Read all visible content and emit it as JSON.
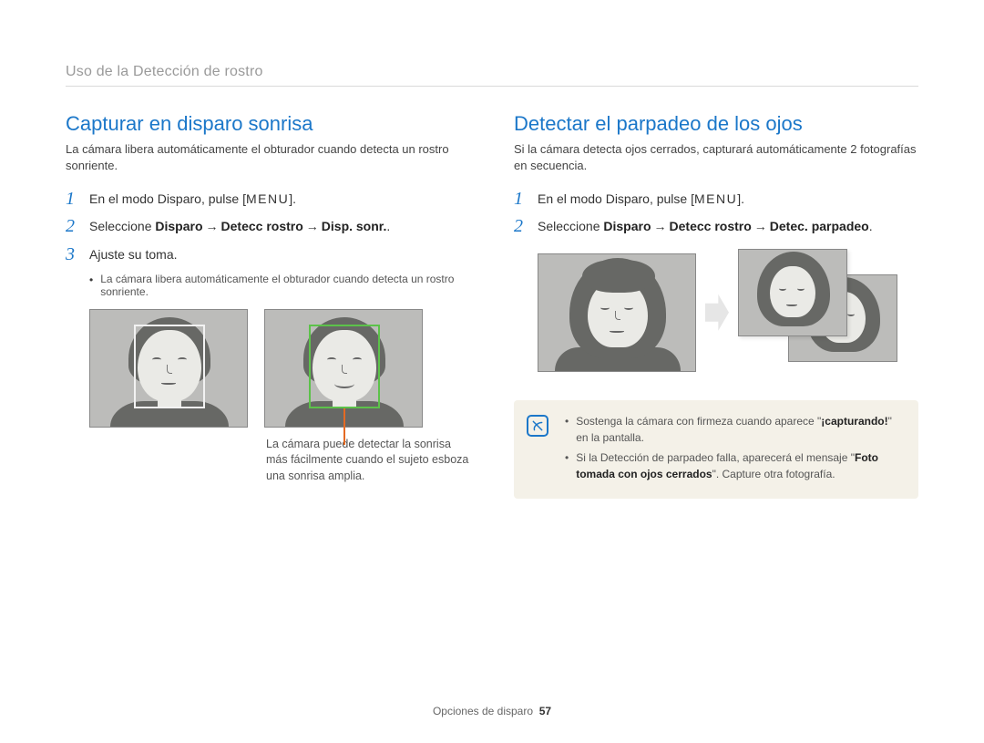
{
  "breadcrumb": "Uso de la Detección de rostro",
  "left": {
    "heading": "Capturar en disparo sonrisa",
    "intro": "La cámara libera automáticamente el obturador cuando detecta un rostro sonriente.",
    "step1_pre": "En el modo Disparo, pulse [",
    "step1_menu": "MENU",
    "step1_post": "].",
    "step2_pre": "Seleccione ",
    "step2_b1": "Disparo",
    "step2_arrow": "→",
    "step2_b2": "Detecc rostro",
    "step2_b3": "Disp. sonr.",
    "step2_post": ".",
    "step3": "Ajuste su toma.",
    "step3_bullet": "La cámara libera automáticamente el obturador cuando detecta un rostro sonriente.",
    "caption": "La cámara puede detectar la sonrisa más fácilmente cuando el sujeto esboza una sonrisa amplia."
  },
  "right": {
    "heading": "Detectar el parpadeo de los ojos",
    "intro": "Si la cámara detecta ojos cerrados, capturará automáticamente 2 fotografías en secuencia.",
    "step1_pre": "En el modo Disparo, pulse [",
    "step1_menu": "MENU",
    "step1_post": "].",
    "step2_pre": "Seleccione ",
    "step2_b1": "Disparo",
    "step2_arrow": "→",
    "step2_b2": "Detecc rostro",
    "step2_b3": "Detec. parpadeo",
    "step2_post": ".",
    "note1_a": "Sostenga la cámara con firmeza cuando aparece \"",
    "note1_b": "¡capturando!",
    "note1_c": "\" en la pantalla.",
    "note2_a": "Si la Detección de parpadeo falla, aparecerá el mensaje \"",
    "note2_b": "Foto tomada con ojos cerrados",
    "note2_c": "\". Capture otra fotografía."
  },
  "footer": {
    "section": "Opciones de disparo",
    "page": "57"
  }
}
